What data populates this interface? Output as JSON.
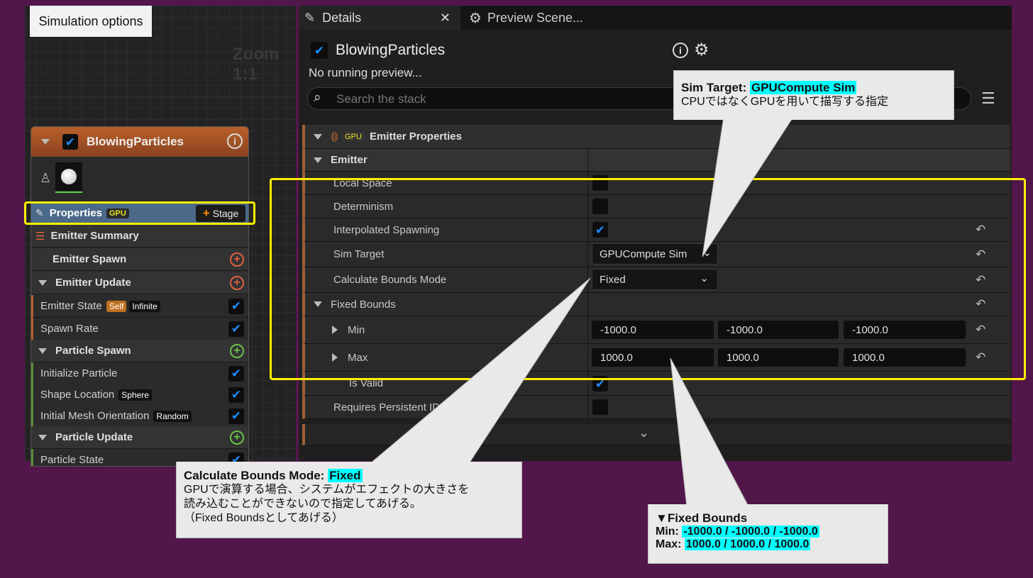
{
  "graph": {
    "sim_options_label": "Simulation options",
    "zoom_label": "Zoom 1:1",
    "node": {
      "title": "BlowingParticles",
      "properties_label": "Properties",
      "gpu_badge": "GPU",
      "stage_label": "Stage",
      "rows": {
        "emitter_summary": "Emitter Summary",
        "emitter_spawn": "Emitter Spawn",
        "emitter_update": "Emitter Update",
        "emitter_state": "Emitter State",
        "emitter_state_badge_self": "Self",
        "emitter_state_badge_infinite": "Infinite",
        "spawn_rate": "Spawn Rate",
        "particle_spawn": "Particle Spawn",
        "initialize_particle": "Initialize Particle",
        "shape_location": "Shape Location",
        "shape_location_badge": "Sphere",
        "initial_mesh_orientation": "Initial Mesh Orientation",
        "initial_mesh_orientation_badge": "Random",
        "particle_update": "Particle Update",
        "particle_state": "Particle State"
      }
    }
  },
  "details": {
    "tab_details": "Details",
    "tab_preview": "Preview Scene...",
    "title": "BlowingParticles",
    "no_preview": "No running preview...",
    "search_placeholder": "Search the stack",
    "section_title": "Emitter Properties",
    "section_gpu_badge": "GPU",
    "emitter_group": "Emitter",
    "props": {
      "local_space": "Local Space",
      "determinism": "Determinism",
      "interpolated_spawning": "Interpolated Spawning",
      "sim_target": "Sim Target",
      "sim_target_value": "GPUCompute Sim",
      "calc_bounds_mode": "Calculate Bounds Mode",
      "calc_bounds_value": "Fixed",
      "fixed_bounds": "Fixed Bounds",
      "min": "Min",
      "max": "Max",
      "min_x": "-1000.0",
      "min_y": "-1000.0",
      "min_z": "-1000.0",
      "max_x": "1000.0",
      "max_y": "1000.0",
      "max_z": "1000.0",
      "is_valid": "Is Valid",
      "requires_persistent_id": "Requires Persistent ID"
    }
  },
  "callouts": {
    "sim_target": {
      "key": "Sim Target:",
      "value": "GPUCompute Sim",
      "text": "CPUではなくGPUを用いて描写する指定"
    },
    "calc_bounds": {
      "key": "Calculate Bounds Mode:",
      "value": "Fixed",
      "line1": "GPUで演算する場合、システムがエフェクトの大きさを",
      "line2": "読み込むことができないので指定してあげる。",
      "line3": "（Fixed Boundsとしてあげる）"
    },
    "fixed_bounds": {
      "title": "▼Fixed Bounds",
      "min_key": "Min:",
      "min_value": "-1000.0 / -1000.0 / -1000.0",
      "max_key": "Max:",
      "max_value": "1000.0 / 1000.0 / 1000.0"
    }
  },
  "colors": {
    "background": "#52164a",
    "highlight": "#00ffff",
    "yellow_frame": "#ffee00",
    "checkbox_blue": "#1f8cff"
  }
}
